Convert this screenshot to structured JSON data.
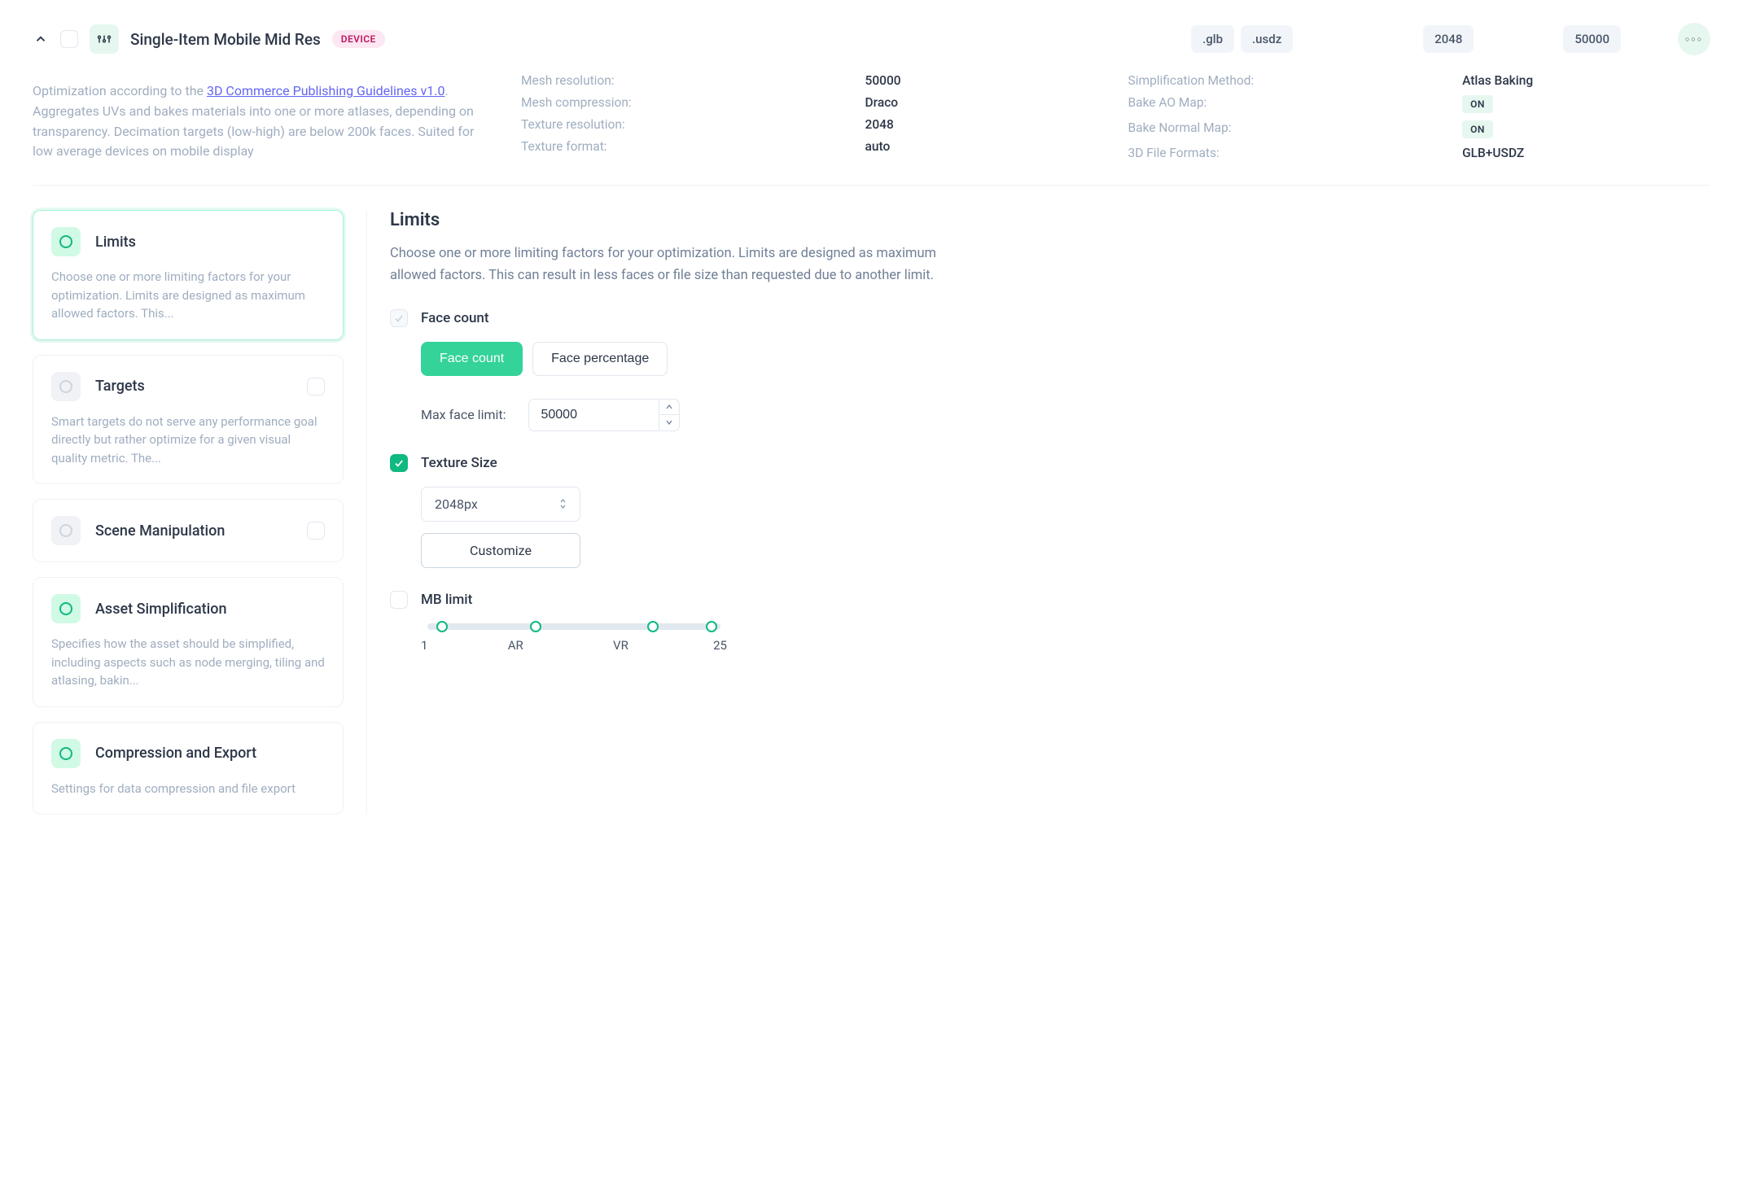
{
  "header": {
    "title": "Single-Item Mobile Mid Res",
    "tag": "DEVICE",
    "pills_formats": [
      ".glb",
      ".usdz"
    ],
    "pill_res": "2048",
    "pill_faces": "50000"
  },
  "description": {
    "prefix": "Optimization according to the ",
    "link_text": "3D Commerce Publishing Guidelines v1.0",
    "suffix": ". Aggregates UVs and bakes materials into one or more atlases, depending on transparency. Decimation targets (low-high) are below 200k faces. Suited for low average devices on mobile display"
  },
  "specs_left": [
    {
      "label": "Mesh resolution:",
      "value": "50000"
    },
    {
      "label": "Mesh compression:",
      "value": "Draco"
    },
    {
      "label": "Texture resolution:",
      "value": "2048"
    },
    {
      "label": "Texture format:",
      "value": "auto"
    }
  ],
  "specs_right": [
    {
      "label": "Simplification Method:",
      "value": "Atlas Baking",
      "type": "text"
    },
    {
      "label": "Bake AO Map:",
      "value": "ON",
      "type": "on"
    },
    {
      "label": "Bake Normal Map:",
      "value": "ON",
      "type": "on"
    },
    {
      "label": "3D File Formats:",
      "value": "GLB+USDZ",
      "type": "text"
    }
  ],
  "sidebar": {
    "items": [
      {
        "title": "Limits",
        "desc": "Choose one or more limiting factors for your optimization. Limits are designed as maximum allowed factors. This...",
        "active": true,
        "icon": "green",
        "sidebox": false
      },
      {
        "title": "Targets",
        "desc": "Smart targets do not serve any performance goal directly but rather optimize for a given visual quality metric. The...",
        "active": false,
        "icon": "grey",
        "sidebox": true
      },
      {
        "title": "Scene Manipulation",
        "desc": "",
        "active": false,
        "icon": "grey",
        "sidebox": true
      },
      {
        "title": "Asset Simplification",
        "desc": "Specifies how the asset should be simplified, including aspects such as node merging, tiling and atlasing, bakin...",
        "active": false,
        "icon": "green",
        "sidebox": false
      },
      {
        "title": "Compression and Export",
        "desc": "Settings for data compression and file export",
        "active": false,
        "icon": "green",
        "sidebox": false
      }
    ]
  },
  "main": {
    "heading": "Limits",
    "description": "Choose one or more limiting factors for your optimization. Limits are designed as maximum allowed factors. This can result in less faces or file size than requested due to another limit.",
    "face_count": {
      "label": "Face count",
      "btn_count": "Face count",
      "btn_pct": "Face percentage",
      "input_label": "Max face limit:",
      "input_value": "50000"
    },
    "texture": {
      "label": "Texture Size",
      "select_value": "2048px",
      "customize": "Customize"
    },
    "mb": {
      "label": "MB limit",
      "ticks": [
        "1",
        "AR",
        "VR",
        "25"
      ]
    }
  }
}
